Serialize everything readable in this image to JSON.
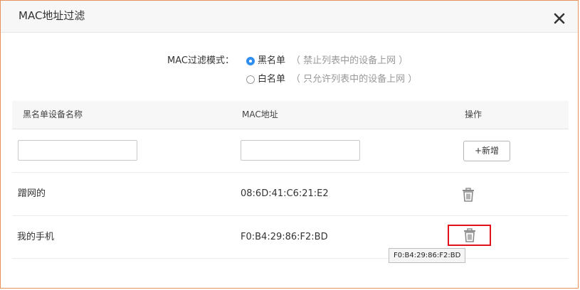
{
  "dialog": {
    "title": "MAC地址过滤",
    "close_icon": "close-icon"
  },
  "filter_mode": {
    "label": "MAC过滤模式：",
    "options": [
      {
        "label": "黑名单",
        "hint": "（ 禁止列表中的设备上网 ）",
        "checked": true
      },
      {
        "label": "白名单",
        "hint": "（ 只允许列表中的设备上网 ）",
        "checked": false
      }
    ]
  },
  "table": {
    "headers": [
      "黑名单设备名称",
      "MAC地址",
      "操作"
    ],
    "new_row": {
      "name_value": "",
      "mac_value": "",
      "add_label": "+新增"
    },
    "rows": [
      {
        "name": "蹭网的",
        "mac": "08:6D:41:C6:21:E2",
        "action_icon": "trash-icon"
      },
      {
        "name": "我的手机",
        "mac": "F0:B4:29:86:F2:BD",
        "action_icon": "trash-icon"
      }
    ]
  },
  "tooltip": {
    "text": "F0:B4:29:86:F2:BD"
  },
  "colors": {
    "accent": "#2f8ef0",
    "highlight": "#e0121a",
    "dialog_border": "#e8915a"
  }
}
